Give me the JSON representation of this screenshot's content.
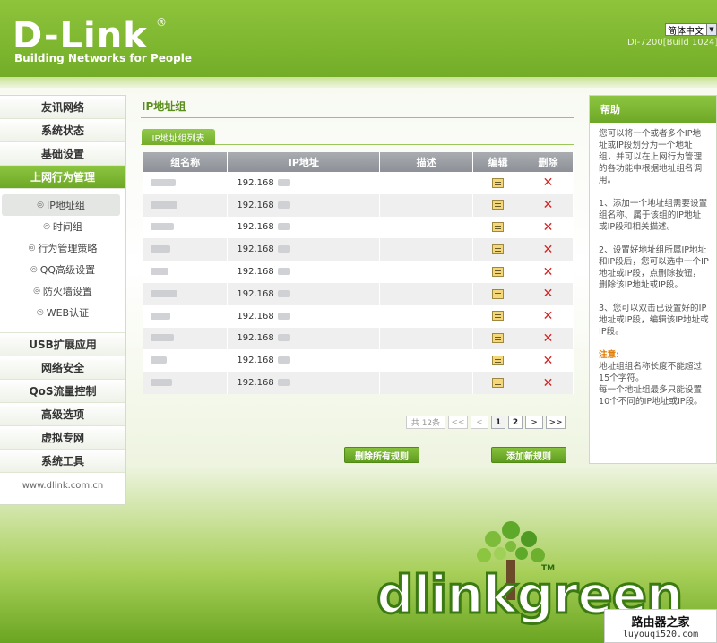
{
  "header": {
    "logo": "D-Link",
    "registered": "®",
    "tagline": "Building Networks for People",
    "language": "简体中文",
    "firmware": "DI-7200[Build 1024]"
  },
  "nav": {
    "items_top": [
      "友讯网络",
      "系统状态",
      "基础设置"
    ],
    "active": "上网行为管理",
    "sub": [
      "IP地址组",
      "时间组",
      "行为管理策略",
      "QQ高级设置",
      "防火墙设置",
      "WEB认证"
    ],
    "items_bottom": [
      "USB扩展应用",
      "网络安全",
      "QoS流量控制",
      "高级选项",
      "虚拟专网",
      "系统工具"
    ],
    "footer": "www.dlink.com.cn"
  },
  "main": {
    "title": "IP地址组",
    "subtab": "IP地址组列表",
    "columns": [
      "组名称",
      "IP地址",
      "描述",
      "编辑",
      "删除"
    ],
    "ip_prefix": "192.168",
    "row_count": 10,
    "pager": {
      "total": "共 12条",
      "first": "<<",
      "prev": "<",
      "page1": "1",
      "page2": "2",
      "next": ">",
      "last": ">>"
    },
    "delete_all": "删除所有规则",
    "add_new": "添加新规则"
  },
  "help": {
    "title": "帮助",
    "intro": "您可以将一个或者多个IP地址或IP段划分为一个地址组，并可以在上网行为管理的各功能中根据地址组名调用。",
    "step1": "1、添加一个地址组需要设置组名称、属于该组的IP地址或IP段和相关描述。",
    "step2": "2、设置好地址组所属IP地址和IP段后，您可以选中一个IP地址或IP段，点删除按钮，删除该IP地址或IP段。",
    "step3": "3、您可以双击已设置好的IP地址或IP段，编辑该IP地址或IP段。",
    "note_title": "注意:",
    "note1": "地址组组名称长度不能超过15个字符。",
    "note2": "每一个地址组最多只能设置10个不同的IP地址或IP段。"
  },
  "footer": {
    "brand": "dlinkgreen",
    "tm": "TM",
    "watermark1": "路由器之家",
    "watermark2": "luyouqi520.com"
  },
  "colors": {
    "accent": "#7ab42e",
    "header_gray": "#979ba1",
    "delete": "#d62424",
    "note": "#e07a00"
  }
}
